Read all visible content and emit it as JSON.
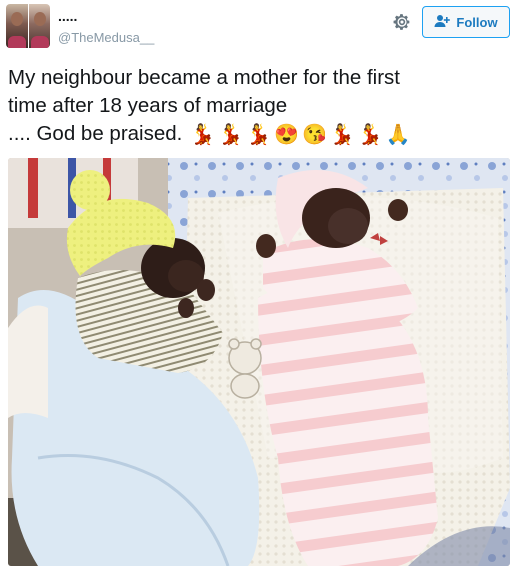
{
  "user": {
    "name": ".....",
    "handle": "@TheMedusa__"
  },
  "follow_button": {
    "label": "Follow"
  },
  "tweet": {
    "line1": "My neighbour became a mother for the first",
    "line2": "time after 18 years of marriage",
    "line3": ".... God be praised.",
    "emojis": "💃💃💃😍😘💃💃🙏"
  },
  "icons": {
    "settings": "gear-icon",
    "follow": "add-user-icon"
  },
  "colors": {
    "accent": "#1da1f2",
    "follow_text": "#1d7bc0",
    "handle": "#8899a6"
  }
}
